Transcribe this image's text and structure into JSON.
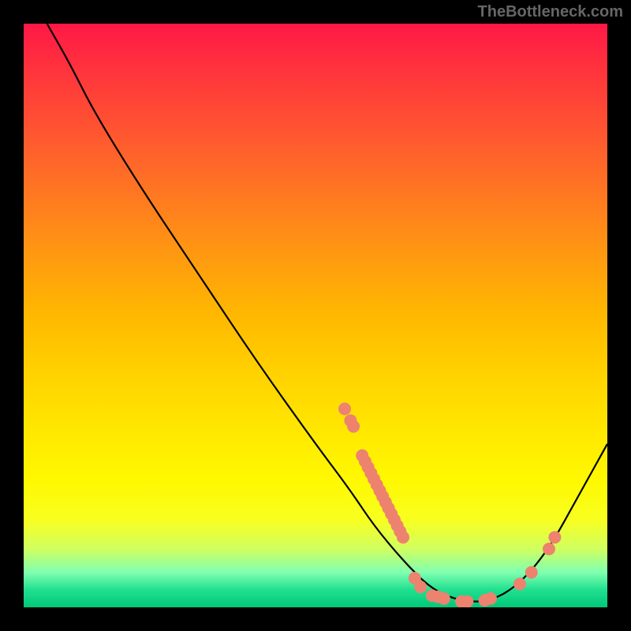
{
  "watermark": "TheBottleneck.com",
  "chart_data": {
    "type": "line",
    "title": "",
    "xlabel": "",
    "ylabel": "",
    "xlim": [
      0,
      100
    ],
    "ylim": [
      0,
      100
    ],
    "series": [
      {
        "name": "curve",
        "points": [
          {
            "x": 4,
            "y": 100
          },
          {
            "x": 8,
            "y": 93
          },
          {
            "x": 12,
            "y": 85
          },
          {
            "x": 20,
            "y": 72
          },
          {
            "x": 30,
            "y": 57
          },
          {
            "x": 40,
            "y": 42
          },
          {
            "x": 50,
            "y": 28
          },
          {
            "x": 56,
            "y": 20
          },
          {
            "x": 60,
            "y": 14
          },
          {
            "x": 65,
            "y": 8
          },
          {
            "x": 70,
            "y": 3
          },
          {
            "x": 75,
            "y": 1
          },
          {
            "x": 80,
            "y": 1
          },
          {
            "x": 85,
            "y": 4
          },
          {
            "x": 90,
            "y": 10
          },
          {
            "x": 95,
            "y": 19
          },
          {
            "x": 100,
            "y": 28
          }
        ]
      }
    ],
    "scatter": [
      {
        "x": 55,
        "y": 34
      },
      {
        "x": 56,
        "y": 32
      },
      {
        "x": 56.5,
        "y": 31
      },
      {
        "x": 58,
        "y": 26
      },
      {
        "x": 58.5,
        "y": 25
      },
      {
        "x": 59,
        "y": 24
      },
      {
        "x": 59.5,
        "y": 23
      },
      {
        "x": 60,
        "y": 22
      },
      {
        "x": 60.5,
        "y": 21
      },
      {
        "x": 61,
        "y": 20
      },
      {
        "x": 61.5,
        "y": 19
      },
      {
        "x": 62,
        "y": 18
      },
      {
        "x": 62.5,
        "y": 17
      },
      {
        "x": 63,
        "y": 16
      },
      {
        "x": 63.5,
        "y": 15
      },
      {
        "x": 64,
        "y": 14
      },
      {
        "x": 64.5,
        "y": 13
      },
      {
        "x": 65,
        "y": 12
      },
      {
        "x": 67,
        "y": 5
      },
      {
        "x": 68,
        "y": 3.5
      },
      {
        "x": 70,
        "y": 2
      },
      {
        "x": 71,
        "y": 1.8
      },
      {
        "x": 72,
        "y": 1.5
      },
      {
        "x": 75,
        "y": 1
      },
      {
        "x": 76,
        "y": 1
      },
      {
        "x": 79,
        "y": 1.2
      },
      {
        "x": 80,
        "y": 1.5
      },
      {
        "x": 85,
        "y": 4
      },
      {
        "x": 87,
        "y": 6
      },
      {
        "x": 90,
        "y": 10
      },
      {
        "x": 91,
        "y": 12
      }
    ],
    "scatter_color": "#ed826f"
  }
}
